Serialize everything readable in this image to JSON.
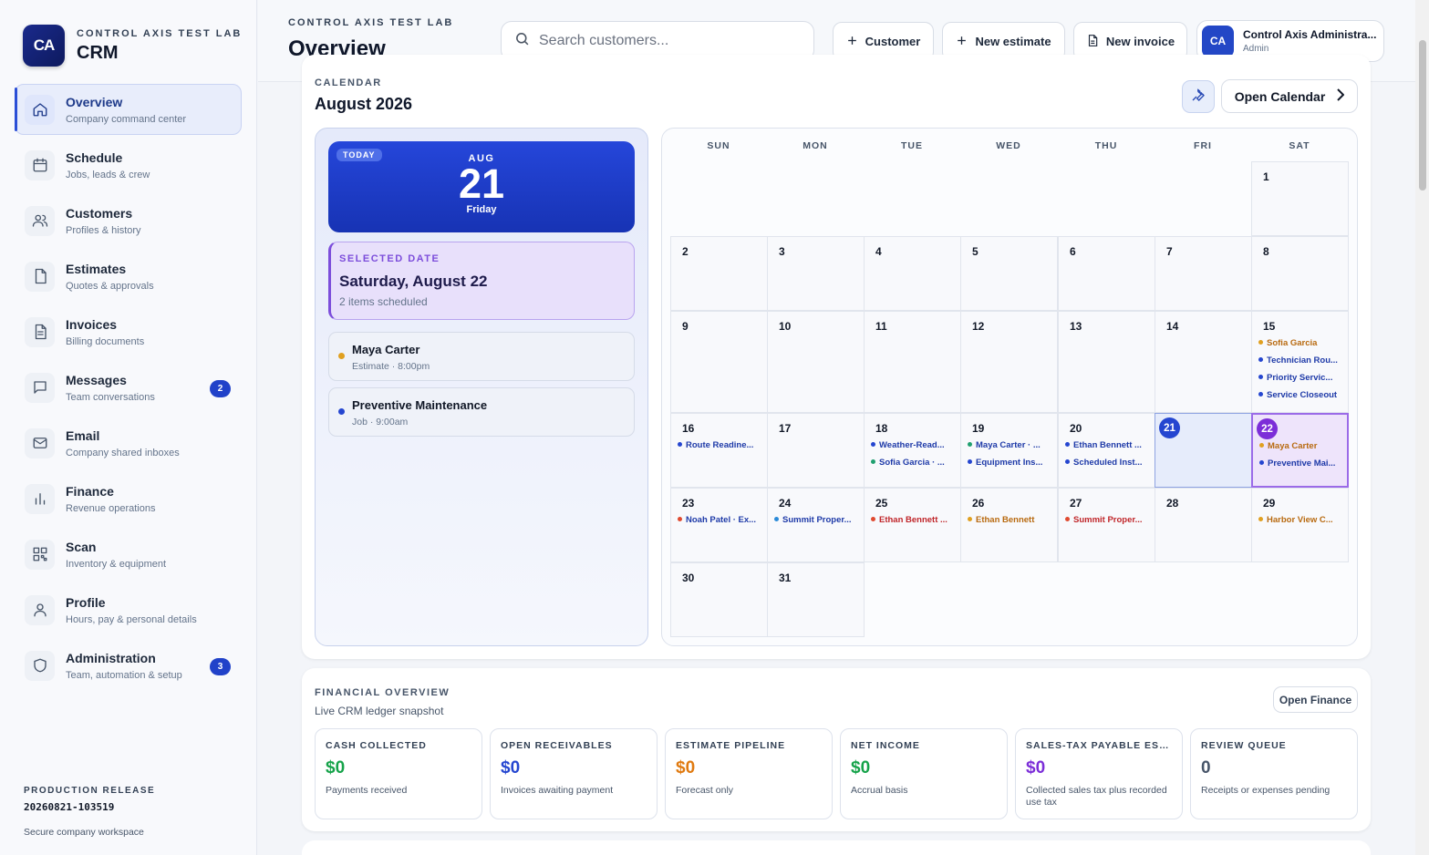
{
  "brand": {
    "subtitle": "CONTROL AXIS TEST LAB",
    "title": "CRM",
    "logo_text": "CA"
  },
  "nav": [
    {
      "label": "Overview",
      "desc": "Company command center",
      "icon": "home-icon",
      "active": true,
      "badge": null
    },
    {
      "label": "Schedule",
      "desc": "Jobs, leads & crew",
      "icon": "calendar-icon",
      "active": false,
      "badge": null
    },
    {
      "label": "Customers",
      "desc": "Profiles & history",
      "icon": "users-icon",
      "active": false,
      "badge": null
    },
    {
      "label": "Estimates",
      "desc": "Quotes & approvals",
      "icon": "file-icon",
      "active": false,
      "badge": null
    },
    {
      "label": "Invoices",
      "desc": "Billing documents",
      "icon": "document-icon",
      "active": false,
      "badge": null
    },
    {
      "label": "Messages",
      "desc": "Team conversations",
      "icon": "chat-icon",
      "active": false,
      "badge": "2"
    },
    {
      "label": "Email",
      "desc": "Company shared inboxes",
      "icon": "mail-icon",
      "active": false,
      "badge": null
    },
    {
      "label": "Finance",
      "desc": "Revenue operations",
      "icon": "bar-chart-icon",
      "active": false,
      "badge": null
    },
    {
      "label": "Scan",
      "desc": "Inventory & equipment",
      "icon": "qr-icon",
      "active": false,
      "badge": null
    },
    {
      "label": "Profile",
      "desc": "Hours, pay & personal details",
      "icon": "person-icon",
      "active": false,
      "badge": null
    },
    {
      "label": "Administration",
      "desc": "Team, automation & setup",
      "icon": "shield-icon",
      "active": false,
      "badge": "3"
    }
  ],
  "release": {
    "label": "PRODUCTION RELEASE",
    "version": "20260821-103519",
    "note": "Secure company workspace"
  },
  "header": {
    "subtitle": "CONTROL AXIS TEST LAB",
    "title": "Overview",
    "search_placeholder": "Search customers...",
    "buttons": {
      "customer": "Customer",
      "estimate": "New estimate",
      "invoice": "New invoice"
    },
    "user": {
      "initials": "CA",
      "name": "Control Axis Administra...",
      "role": "Admin"
    }
  },
  "calendar": {
    "eyebrow": "CALENDAR",
    "month": "August 2026",
    "open_label": "Open Calendar",
    "today": {
      "tag": "TODAY",
      "month": "AUG",
      "day": "21",
      "weekday": "Friday"
    },
    "selected": {
      "label": "SELECTED DATE",
      "date": "Saturday, August 22",
      "count": "2 items scheduled"
    },
    "selected_events": [
      {
        "title": "Maya Carter",
        "sub": "Estimate · 8:00pm",
        "color": "#e0a020"
      },
      {
        "title": "Preventive Maintenance",
        "sub": "Job · 9:00am",
        "color": "#2546d0"
      }
    ],
    "weekdays": [
      "SUN",
      "MON",
      "TUE",
      "WED",
      "THU",
      "FRI",
      "SAT"
    ],
    "first_weekday": 6,
    "days_in_month": 31,
    "today_day": 21,
    "selected_day": 22,
    "events": {
      "15": [
        {
          "t": "Sofia Garcia",
          "c": "#b86a10",
          "d": "#e0a020"
        },
        {
          "t": "Technician Rou...",
          "c": "#1e3aa8",
          "d": "#2546d0"
        },
        {
          "t": "Priority Servic...",
          "c": "#1e3aa8",
          "d": "#2546d0"
        },
        {
          "t": "Service Closeout",
          "c": "#1e3aa8",
          "d": "#2546d0"
        }
      ],
      "16": [
        {
          "t": "Route Readine...",
          "c": "#1e3aa8",
          "d": "#2546d0"
        }
      ],
      "18": [
        {
          "t": "Weather-Read...",
          "c": "#1e3aa8",
          "d": "#2546d0"
        },
        {
          "t": "Sofia Garcia · ...",
          "c": "#1e3aa8",
          "d": "#20a070"
        }
      ],
      "19": [
        {
          "t": "Maya Carter · ...",
          "c": "#1e3aa8",
          "d": "#20a070"
        },
        {
          "t": "Equipment Ins...",
          "c": "#1e3aa8",
          "d": "#2546d0"
        }
      ],
      "20": [
        {
          "t": "Ethan Bennett ...",
          "c": "#1e3aa8",
          "d": "#2546d0"
        },
        {
          "t": "Scheduled Inst...",
          "c": "#1e3aa8",
          "d": "#2546d0"
        }
      ],
      "22": [
        {
          "t": "Maya Carter",
          "c": "#b86a10",
          "d": "#e0a020"
        },
        {
          "t": "Preventive Mai...",
          "c": "#1e3aa8",
          "d": "#2546d0"
        }
      ],
      "23": [
        {
          "t": "Noah Patel · Ex...",
          "c": "#1e3aa8",
          "d": "#e04a30"
        }
      ],
      "24": [
        {
          "t": "Summit Proper...",
          "c": "#1e3aa8",
          "d": "#2a8ad8"
        }
      ],
      "25": [
        {
          "t": "Ethan Bennett ...",
          "c": "#c0262a",
          "d": "#e04a30"
        }
      ],
      "26": [
        {
          "t": "Ethan Bennett",
          "c": "#b86a10",
          "d": "#e0a020"
        }
      ],
      "27": [
        {
          "t": "Summit Proper...",
          "c": "#c0262a",
          "d": "#e04a30"
        }
      ],
      "29": [
        {
          "t": "Harbor View C...",
          "c": "#b86a10",
          "d": "#e0a020"
        }
      ]
    }
  },
  "finance": {
    "title": "FINANCIAL OVERVIEW",
    "subtitle": "Live CRM ledger snapshot",
    "open_label": "Open Finance",
    "metrics": [
      {
        "label": "CASH COLLECTED",
        "value": "$0",
        "note": "Payments received",
        "color": "#16a34a"
      },
      {
        "label": "OPEN RECEIVABLES",
        "value": "$0",
        "note": "Invoices awaiting payment",
        "color": "#2546d0"
      },
      {
        "label": "ESTIMATE PIPELINE",
        "value": "$0",
        "note": "Forecast only",
        "color": "#e07a10"
      },
      {
        "label": "NET INCOME",
        "value": "$0",
        "note": "Accrual basis",
        "color": "#16a34a"
      },
      {
        "label": "SALES-TAX PAYABLE ESTI...",
        "value": "$0",
        "note": "Collected sales tax plus recorded use tax",
        "color": "#7c2ed8"
      },
      {
        "label": "REVIEW QUEUE",
        "value": "0",
        "note": "Receipts or expenses pending",
        "color": "#475569"
      }
    ]
  }
}
